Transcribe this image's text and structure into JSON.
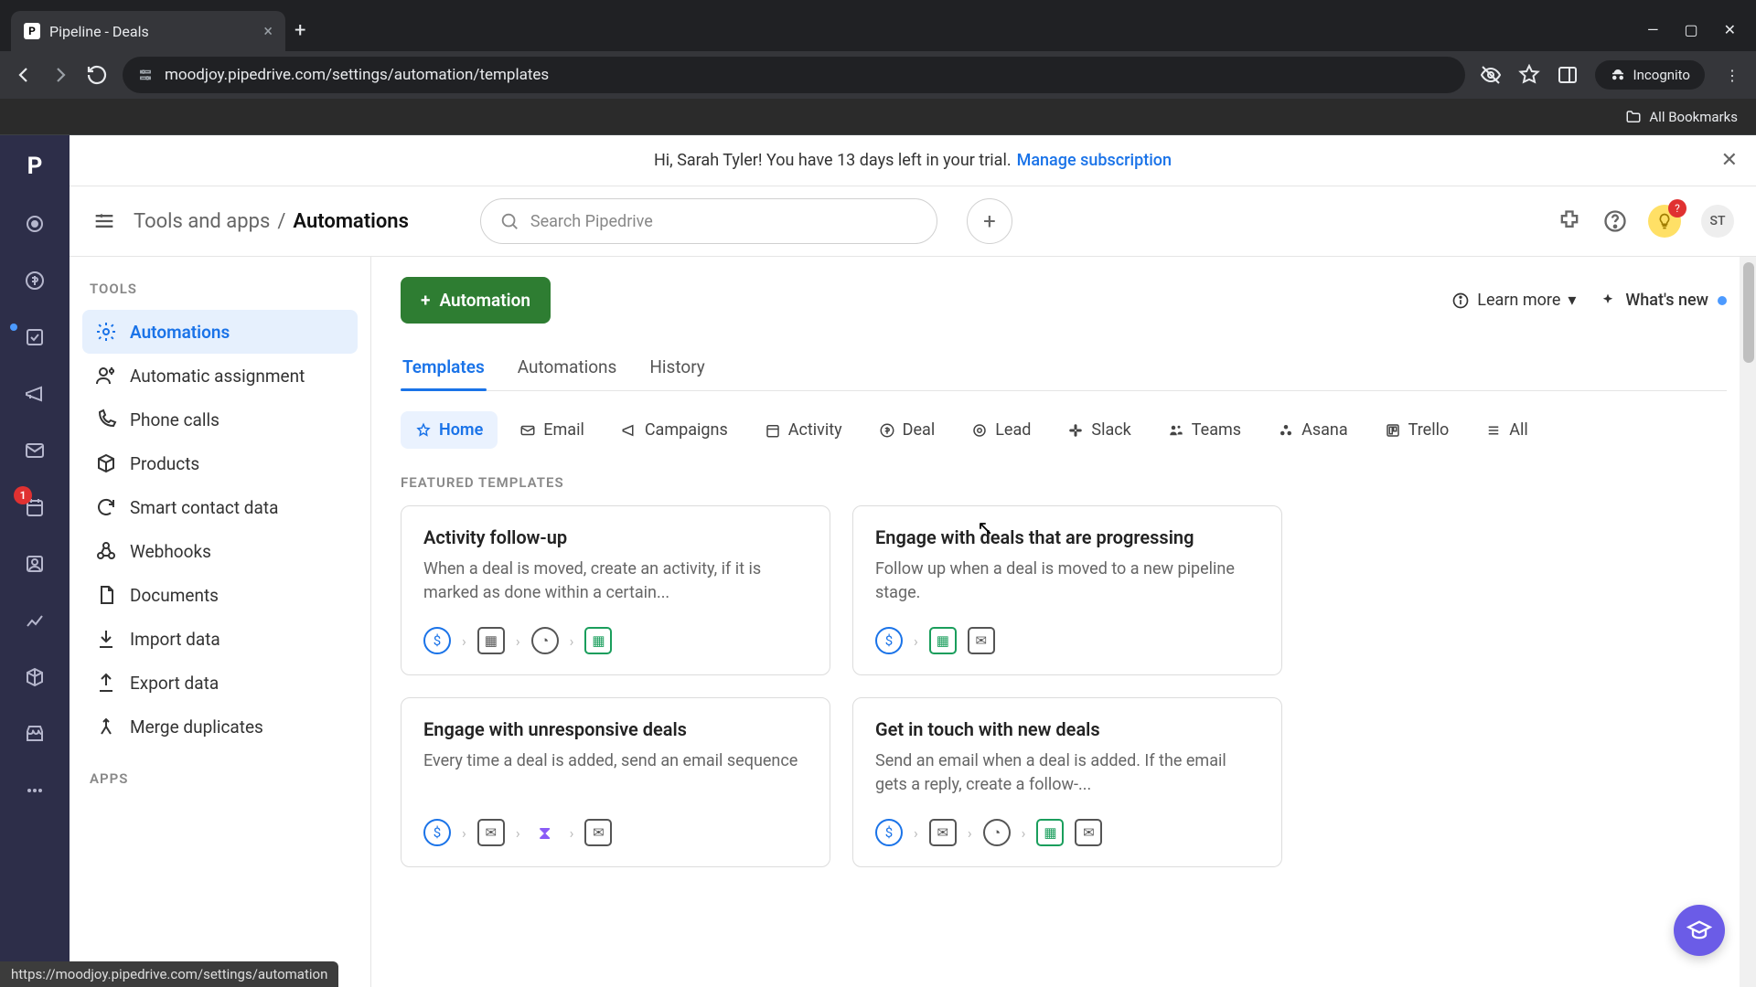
{
  "browser": {
    "tab_title": "Pipeline - Deals",
    "url": "moodjoy.pipedrive.com/settings/automation/templates",
    "incognito_label": "Incognito",
    "bookmarks_label": "All Bookmarks"
  },
  "banner": {
    "text": "Hi, Sarah Tyler! You have 13 days left in your trial.",
    "link": "Manage subscription"
  },
  "topbar": {
    "crumb_parent": "Tools and apps",
    "crumb_sep": "/",
    "crumb_current": "Automations",
    "search_placeholder": "Search Pipedrive",
    "help_badge": "?",
    "avatar": "ST"
  },
  "sidebar": {
    "header_tools": "TOOLS",
    "header_apps": "APPS",
    "items": [
      {
        "label": "Automations",
        "active": true
      },
      {
        "label": "Automatic assignment"
      },
      {
        "label": "Phone calls"
      },
      {
        "label": "Products"
      },
      {
        "label": "Smart contact data"
      },
      {
        "label": "Webhooks"
      },
      {
        "label": "Documents"
      },
      {
        "label": "Import data"
      },
      {
        "label": "Export data"
      },
      {
        "label": "Merge duplicates"
      }
    ]
  },
  "content": {
    "primary_btn": "Automation",
    "learn_more": "Learn more",
    "whats_new": "What's new",
    "tabs": [
      "Templates",
      "Automations",
      "History"
    ],
    "filters": [
      "Home",
      "Email",
      "Campaigns",
      "Activity",
      "Deal",
      "Lead",
      "Slack",
      "Teams",
      "Asana",
      "Trello",
      "All"
    ],
    "featured_label": "FEATURED TEMPLATES",
    "cards": [
      {
        "title": "Activity follow-up",
        "desc": "When a deal is moved, create an activity, if it is marked as done within a certain..."
      },
      {
        "title": "Engage with deals that are progressing",
        "desc": "Follow up when a deal is moved to a new pipeline stage."
      },
      {
        "title": "Engage with unresponsive deals",
        "desc": "Every time a deal is added, send an email sequence"
      },
      {
        "title": "Get in touch with new deals",
        "desc": "Send an email when a deal is added. If the email gets a reply, create a follow-..."
      }
    ]
  },
  "rail_badge": "1",
  "status_url": "https://moodjoy.pipedrive.com/settings/automation"
}
